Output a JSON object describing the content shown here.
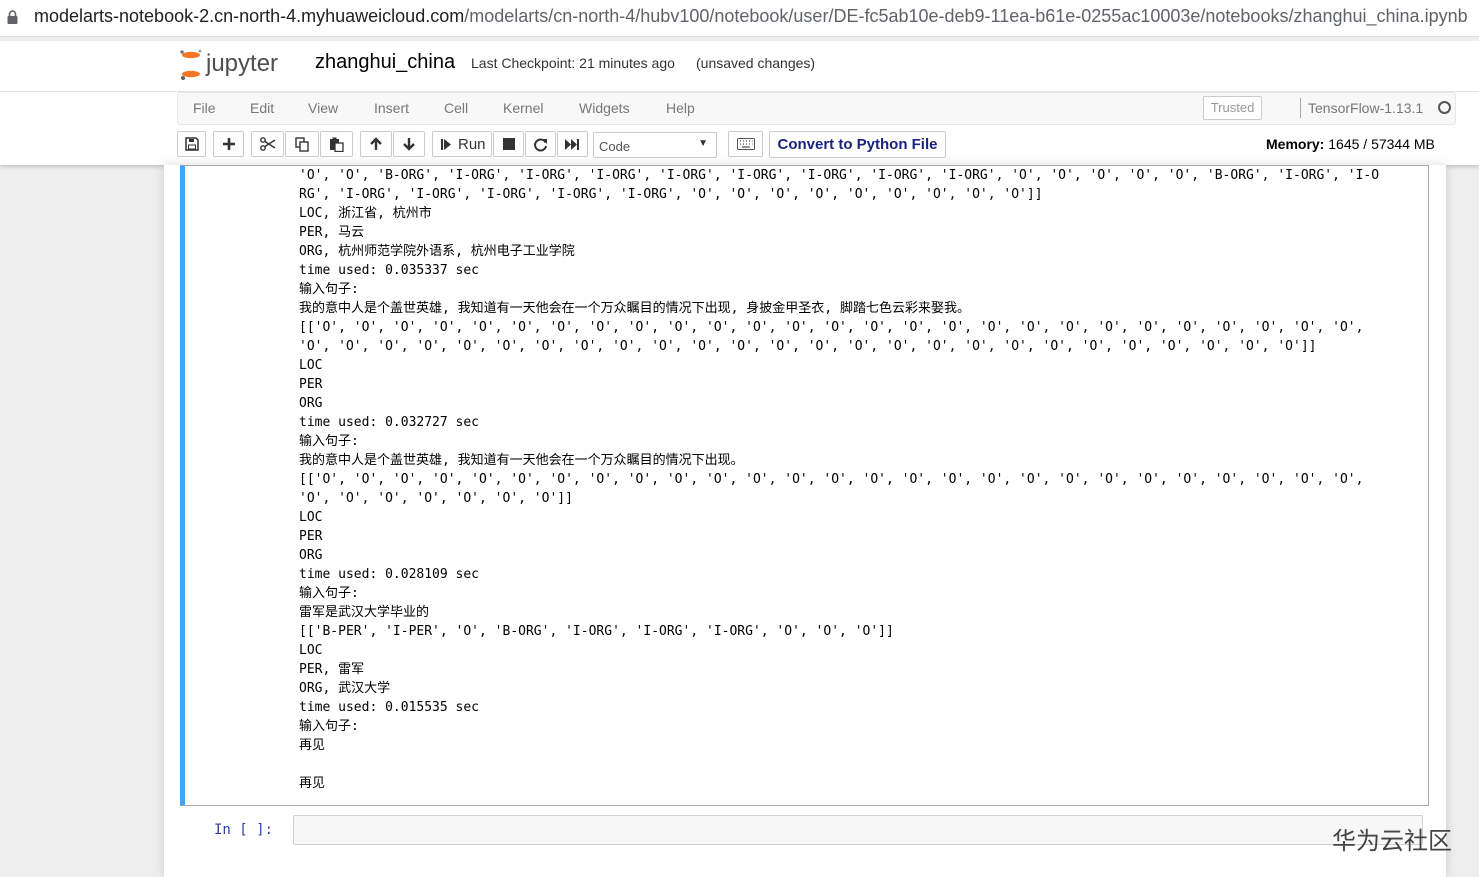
{
  "browser": {
    "url_host": "modelarts-notebook-2.cn-north-4.myhuaweicloud.com",
    "url_path": "/modelarts/cn-north-4/hubv100/notebook/user/DE-fc5ab10e-deb9-11ea-b61e-0255ac10003e/notebooks/zhanghui_china.ipynb"
  },
  "header": {
    "logo_text": "jupyter",
    "notebook_name": "zhanghui_china",
    "checkpoint": "Last Checkpoint: 21 minutes ago",
    "save_status": "(unsaved changes)"
  },
  "menubar": {
    "items": [
      "File",
      "Edit",
      "View",
      "Insert",
      "Cell",
      "Kernel",
      "Widgets",
      "Help"
    ],
    "trusted": "Trusted",
    "kernel_name": "TensorFlow-1.13.1"
  },
  "toolbar": {
    "run_label": "Run",
    "cell_type": "Code",
    "convert_label": "Convert to Python File",
    "memory_label": "Memory:",
    "memory_value": "1645 / 57344 MB",
    "icons": [
      "save-icon",
      "plus-icon",
      "cut-icon",
      "copy-icon",
      "paste-icon",
      "arrow-up-icon",
      "arrow-down-icon",
      "step-forward-icon",
      "stop-icon",
      "restart-icon",
      "fast-forward-icon",
      "keyboard-icon"
    ]
  },
  "output": {
    "lines": [
      "'O', 'O', 'B-ORG', 'I-ORG', 'I-ORG', 'I-ORG', 'I-ORG', 'I-ORG', 'I-ORG', 'I-ORG', 'I-ORG', 'O', 'O', 'O', 'O', 'O', 'B-ORG', 'I-ORG', 'I-O",
      "RG', 'I-ORG', 'I-ORG', 'I-ORG', 'I-ORG', 'I-ORG', 'O', 'O', 'O', 'O', 'O', 'O', 'O', 'O', 'O']]",
      "LOC, 浙江省, 杭州市",
      "PER, 马云",
      "ORG, 杭州师范学院外语系, 杭州电子工业学院",
      "time used: 0.035337 sec",
      "输入句子:",
      "我的意中人是个盖世英雄, 我知道有一天他会在一个万众瞩目的情况下出现, 身披金甲圣衣, 脚踏七色云彩来娶我。",
      "[['O', 'O', 'O', 'O', 'O', 'O', 'O', 'O', 'O', 'O', 'O', 'O', 'O', 'O', 'O', 'O', 'O', 'O', 'O', 'O', 'O', 'O', 'O', 'O', 'O', 'O', 'O',",
      "'O', 'O', 'O', 'O', 'O', 'O', 'O', 'O', 'O', 'O', 'O', 'O', 'O', 'O', 'O', 'O', 'O', 'O', 'O', 'O', 'O', 'O', 'O', 'O', 'O', 'O']]",
      "LOC",
      "PER",
      "ORG",
      "time used: 0.032727 sec",
      "输入句子:",
      "我的意中人是个盖世英雄, 我知道有一天他会在一个万众瞩目的情况下出现。",
      "[['O', 'O', 'O', 'O', 'O', 'O', 'O', 'O', 'O', 'O', 'O', 'O', 'O', 'O', 'O', 'O', 'O', 'O', 'O', 'O', 'O', 'O', 'O', 'O', 'O', 'O', 'O',",
      "'O', 'O', 'O', 'O', 'O', 'O', 'O']]",
      "LOC",
      "PER",
      "ORG",
      "time used: 0.028109 sec",
      "输入句子:",
      "雷军是武汉大学毕业的",
      "[['B-PER', 'I-PER', 'O', 'B-ORG', 'I-ORG', 'I-ORG', 'I-ORG', 'O', 'O', 'O']]",
      "LOC",
      "PER, 雷军",
      "ORG, 武汉大学",
      "time used: 0.015535 sec",
      "输入句子:",
      "再见",
      "",
      "再见"
    ]
  },
  "next_cell": {
    "prompt": "In [ ]:"
  },
  "watermark": "华为云社区"
}
